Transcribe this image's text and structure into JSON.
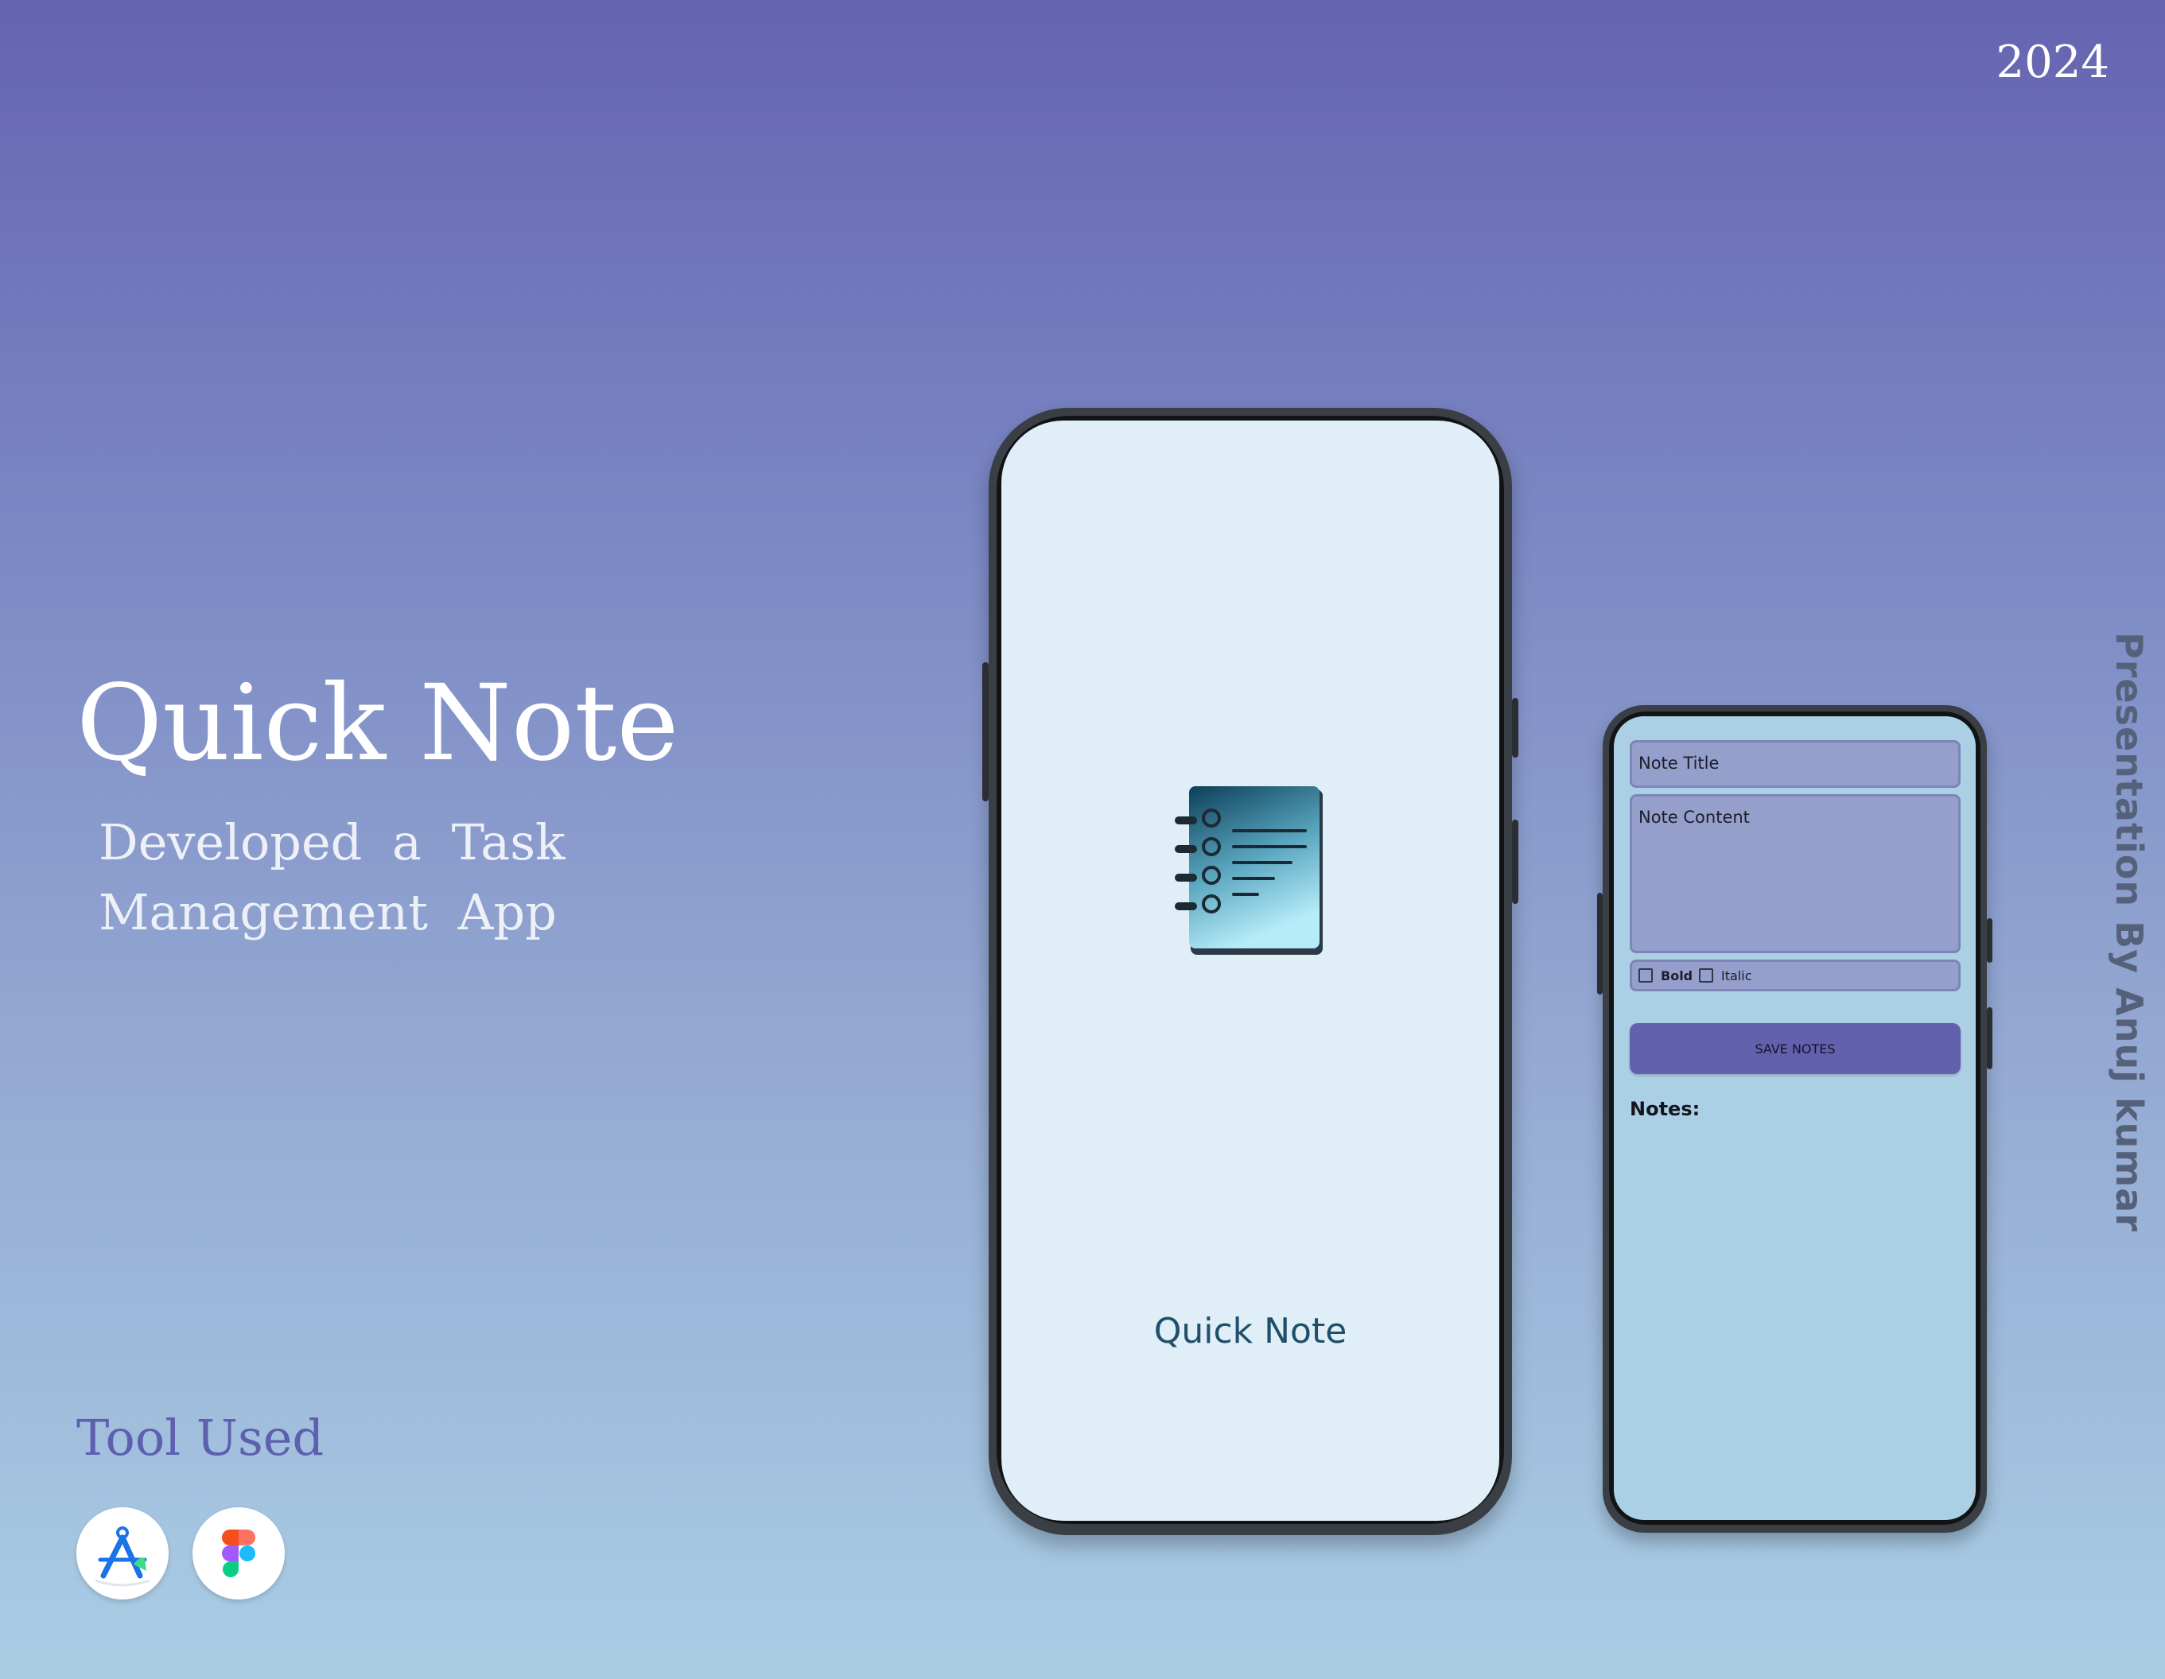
{
  "header": {
    "year": "2024"
  },
  "credit": {
    "text": "Presentation By Anuj kumar"
  },
  "hero": {
    "title": "Quick Note",
    "subtitle": "Developed a Task Management App"
  },
  "tools": {
    "heading": "Tool Used",
    "items": [
      {
        "icon": "android-studio-icon"
      },
      {
        "icon": "figma-icon"
      }
    ]
  },
  "splash_screen": {
    "app_name": "Quick Note",
    "icon": "notebook-icon"
  },
  "editor_screen": {
    "title_placeholder": "Note Title",
    "content_placeholder": "Note Content",
    "bold_label": "Bold",
    "italic_label": "Italic",
    "save_label": "SAVE NOTES",
    "notes_label": "Notes:"
  },
  "colors": {
    "accent": "#6360ad",
    "splash_bg": "#e0eef7",
    "editor_bg": "#abd0e6",
    "input_bg": "#949fcc"
  }
}
